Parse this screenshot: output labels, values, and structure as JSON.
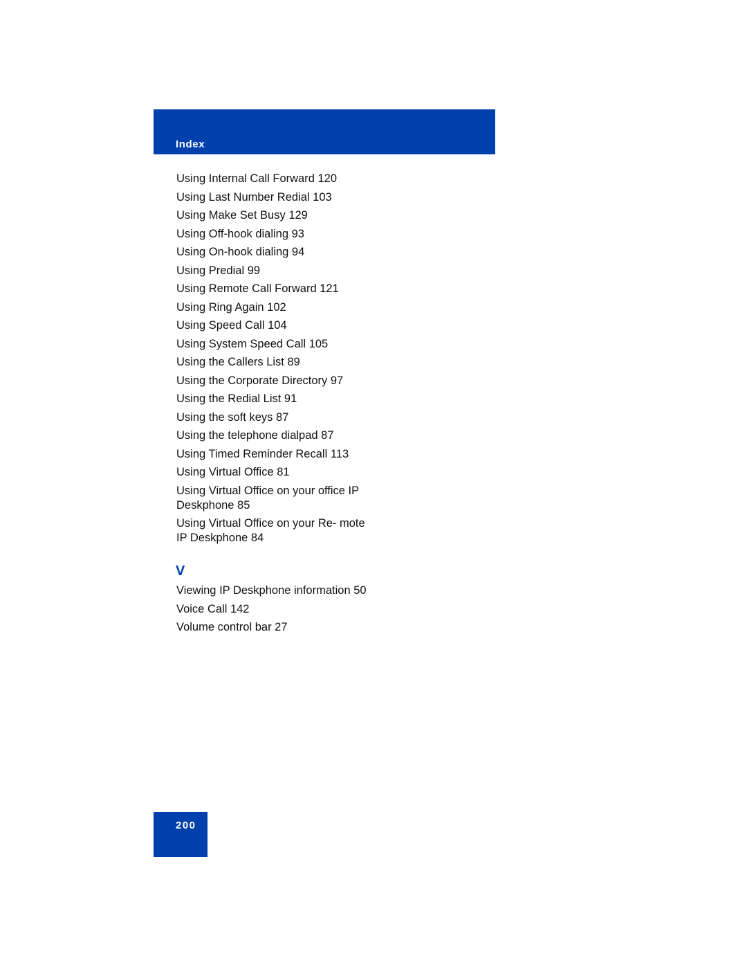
{
  "header": {
    "title": "Index"
  },
  "entries_u": [
    {
      "text": "Using Internal Call Forward 120"
    },
    {
      "text": "Using Last Number Redial 103"
    },
    {
      "text": "Using Make Set Busy 129"
    },
    {
      "text": "Using Off-hook dialing 93"
    },
    {
      "text": "Using On-hook dialing 94"
    },
    {
      "text": "Using Predial 99"
    },
    {
      "text": "Using Remote Call Forward 121"
    },
    {
      "text": "Using Ring Again 102"
    },
    {
      "text": "Using Speed Call 104"
    },
    {
      "text": "Using System Speed Call 105"
    },
    {
      "text": "Using the Callers List 89"
    },
    {
      "text": "Using the Corporate Directory 97"
    },
    {
      "text": "Using the Redial List 91"
    },
    {
      "text": "Using the soft keys 87"
    },
    {
      "text": "Using the telephone dialpad 87"
    },
    {
      "text": "Using Timed Reminder Recall 113"
    },
    {
      "text": "Using Virtual Office 81"
    },
    {
      "text": "Using Virtual Office on your office IP Deskphone 85"
    },
    {
      "text": "Using Virtual Office on your Re- mote IP Deskphone 84"
    }
  ],
  "section_v": {
    "letter": "V",
    "entries": [
      {
        "text": "Viewing IP Deskphone information 50"
      },
      {
        "text": "Voice Call 142"
      },
      {
        "text": "Volume control bar 27"
      }
    ]
  },
  "footer": {
    "page_number": "200"
  }
}
